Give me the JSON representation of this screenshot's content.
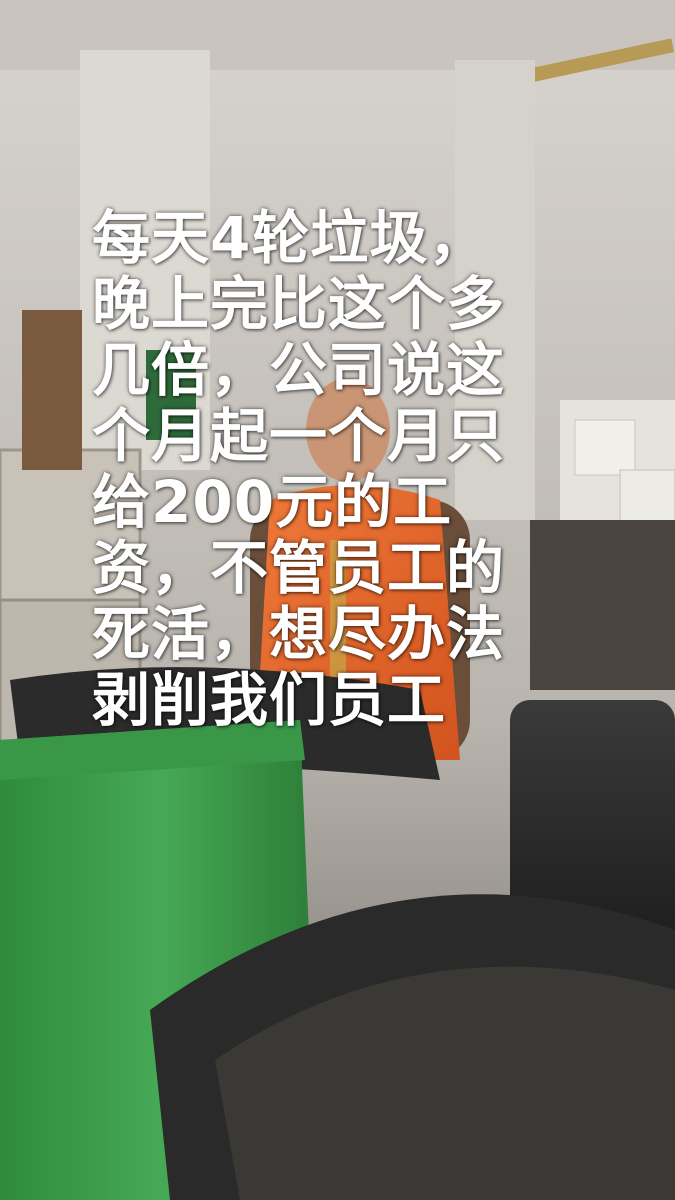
{
  "caption": {
    "lines": [
      "每天4轮垃圾，",
      "晚上完比这个多",
      "几倍，公司说这",
      "个月起一个月只",
      "给200元的工",
      "资，不管员工的",
      "死活，想尽办法",
      "剥削我们员工"
    ],
    "color": "#ffffff"
  },
  "scene": {
    "subject": "worker-in-orange-vest",
    "colors": {
      "vest": "#e8642a",
      "green_bin": "#3f9c4c",
      "black_bin": "#2a2a2a",
      "wall": "#cfcbc5"
    }
  }
}
